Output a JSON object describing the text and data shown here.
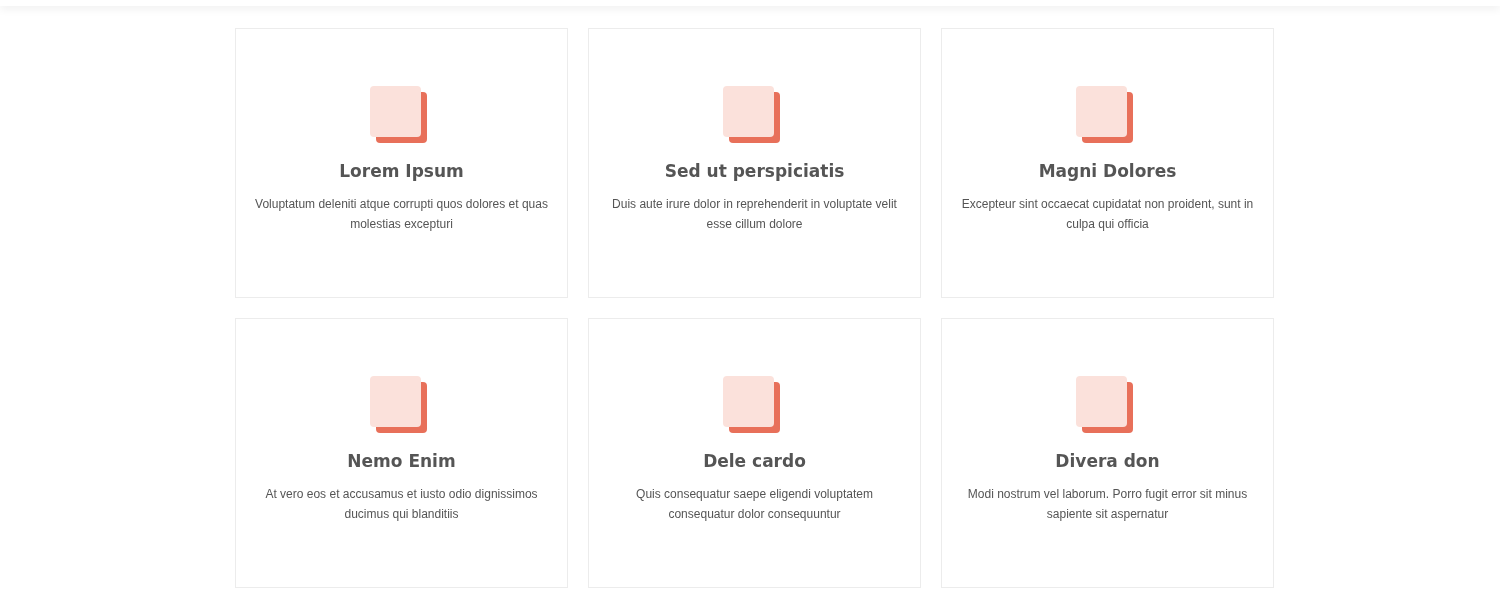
{
  "cards": [
    {
      "title": "Lorem Ipsum",
      "description": "Voluptatum deleniti atque corrupti quos dolores et quas molestias excepturi"
    },
    {
      "title": "Sed ut perspiciatis",
      "description": "Duis aute irure dolor in reprehenderit in voluptate velit esse cillum dolore"
    },
    {
      "title": "Magni Dolores",
      "description": "Excepteur sint occaecat cupidatat non proident, sunt in culpa qui officia"
    },
    {
      "title": "Nemo Enim",
      "description": "At vero eos et accusamus et iusto odio dignissimos ducimus qui blanditiis"
    },
    {
      "title": "Dele cardo",
      "description": "Quis consequatur saepe eligendi voluptatem consequatur dolor consequuntur"
    },
    {
      "title": "Divera don",
      "description": "Modi nostrum vel laborum. Porro fugit error sit minus sapiente sit aspernatur"
    }
  ]
}
